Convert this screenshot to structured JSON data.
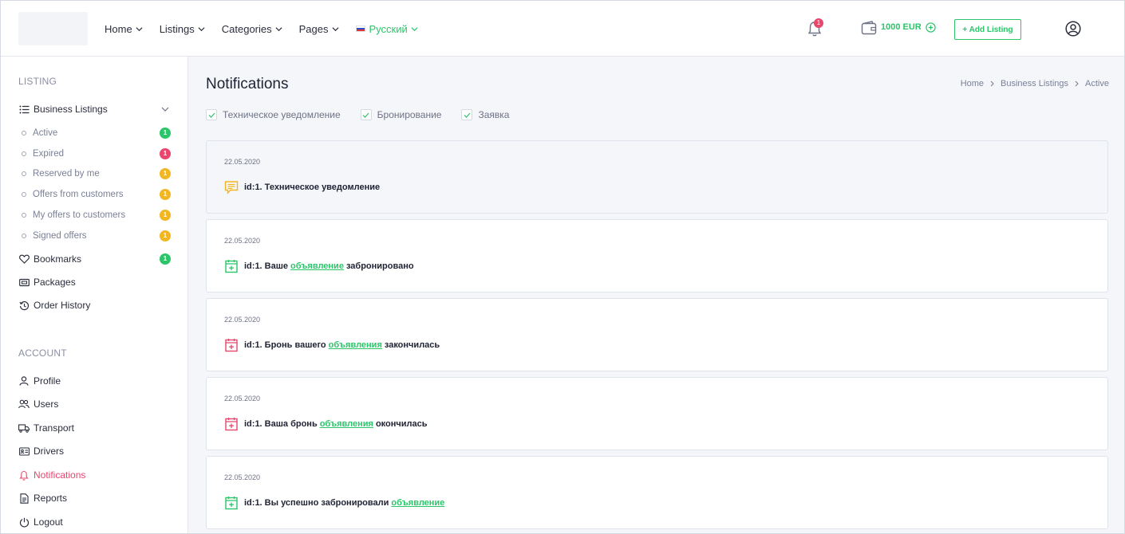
{
  "header": {
    "nav": [
      {
        "label": "Home"
      },
      {
        "label": "Listings"
      },
      {
        "label": "Categories"
      },
      {
        "label": "Pages"
      }
    ],
    "language": "Русский",
    "notifications_count": "1",
    "balance": "1000 EUR",
    "add_listing_label": "+ Add Listing"
  },
  "sidebar": {
    "listing_title": "LISTING",
    "business_listings": "Business Listings",
    "sub_items": [
      {
        "label": "Active",
        "count": "1",
        "status": "green"
      },
      {
        "label": "Expired",
        "count": "1",
        "status": "red"
      },
      {
        "label": "Reserved by me",
        "count": "1",
        "status": "yellow"
      },
      {
        "label": "Offers from customers",
        "count": "1",
        "status": "yellow"
      },
      {
        "label": "My offers to customers",
        "count": "1",
        "status": "yellow"
      },
      {
        "label": "Signed offers",
        "count": "1",
        "status": "yellow"
      }
    ],
    "bookmarks": {
      "label": "Bookmarks",
      "count": "1"
    },
    "packages": "Packages",
    "order_history": "Order History",
    "account_title": "ACCOUNT",
    "account_items": [
      {
        "label": "Profile",
        "icon": "user-icon"
      },
      {
        "label": "Users",
        "icon": "users-icon"
      },
      {
        "label": "Transport",
        "icon": "truck-icon"
      },
      {
        "label": "Drivers",
        "icon": "id-card-icon"
      },
      {
        "label": "Notifications",
        "icon": "bell-icon",
        "active": true
      },
      {
        "label": "Reports",
        "icon": "document-icon"
      },
      {
        "label": "Logout",
        "icon": "power-icon"
      }
    ]
  },
  "main": {
    "title": "Notifications",
    "breadcrumb": [
      "Home",
      "Business Listings",
      "Active"
    ],
    "filters": [
      "Техническое уведомление",
      "Бронирование",
      "Заявка"
    ],
    "notifications": [
      {
        "date": "22.05.2020",
        "icon": "message-icon",
        "color": "#f3b623",
        "pre": "id:1. Техническое уведомление",
        "link": "",
        "post": ""
      },
      {
        "date": "22.05.2020",
        "icon": "calendar-icon",
        "color": "#2bc56a",
        "pre": "id:1. Ваше",
        "link": "объявление",
        "post": "забронировано"
      },
      {
        "date": "22.05.2020",
        "icon": "calendar-icon",
        "color": "#e8466d",
        "pre": "id:1. Бронь вашего",
        "link": "объявления",
        "post": "закончилась"
      },
      {
        "date": "22.05.2020",
        "icon": "calendar-icon",
        "color": "#e8466d",
        "pre": "id:1. Ваша бронь",
        "link": "объявления",
        "post": "окончилась"
      },
      {
        "date": "22.05.2020",
        "icon": "calendar-icon",
        "color": "#2bc56a",
        "pre": "id:1. Вы успешно забронировали",
        "link": "объявление",
        "post": ""
      }
    ]
  },
  "colors": {
    "accent_green": "#2bc56a",
    "accent_red": "#e8466d",
    "accent_yellow": "#f3b623"
  }
}
